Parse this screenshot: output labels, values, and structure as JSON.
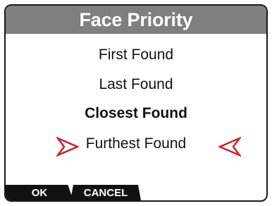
{
  "title": "Face Priority",
  "menu": {
    "items": [
      {
        "label": "First Found"
      },
      {
        "label": "Last Found"
      },
      {
        "label": "Closest Found",
        "selected": true
      },
      {
        "label": "Furthest Found"
      }
    ]
  },
  "softkeys": {
    "ok_label": "OK",
    "cancel_label": "CANCEL"
  },
  "colors": {
    "title_bg": "#7f7f7f",
    "selector_arrow": "#d31e25",
    "softkey_bg": "#111111"
  },
  "icons": {
    "selector_left": "chevron-right-icon",
    "selector_right": "chevron-left-icon"
  }
}
